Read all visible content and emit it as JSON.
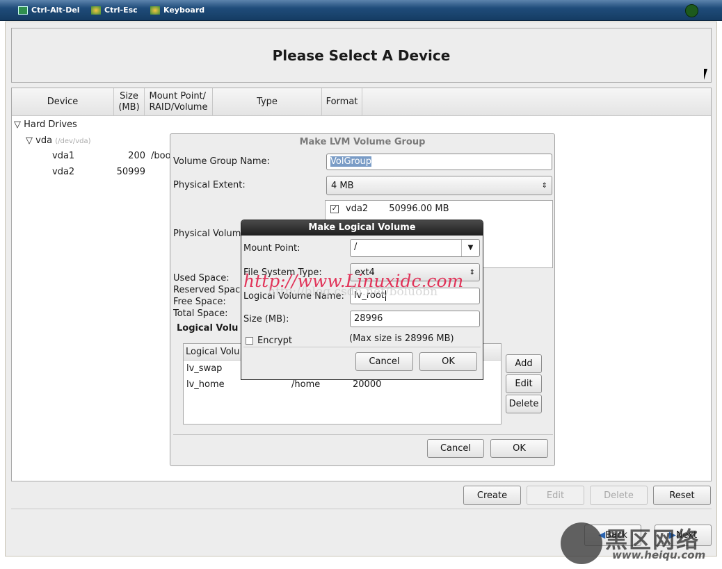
{
  "topbar": {
    "items": [
      {
        "label": "Ctrl-Alt-Del",
        "icon": "monitor-icon"
      },
      {
        "label": "Ctrl-Esc",
        "icon": "app-icon"
      },
      {
        "label": "Keyboard",
        "icon": "keyboard-icon"
      }
    ],
    "status_color": "#1d5a1d"
  },
  "header": {
    "title": "Please Select A Device"
  },
  "table": {
    "columns": [
      "Device",
      "Size\n(MB)",
      "Mount Point/\nRAID/Volume",
      "Type",
      "Format"
    ],
    "group": "Hard Drives",
    "disk": {
      "name": "vda",
      "path": "(/dev/vda)"
    },
    "rows": [
      {
        "device": "vda1",
        "size": "200",
        "mount": "/boo"
      },
      {
        "device": "vda2",
        "size": "50999",
        "mount": ""
      }
    ]
  },
  "lvm_dialog": {
    "title": "Make LVM Volume Group",
    "vg_name_label": "Volume Group Name:",
    "vg_name": "VolGroup",
    "pe_label": "Physical Extent:",
    "pe_value": "4 MB",
    "pv_label": "Physical Volum",
    "pv_list": [
      {
        "checked": true,
        "name": "vda2",
        "size": "50996.00 MB"
      }
    ],
    "space_labels": [
      "Used Space:",
      "Reserved Space",
      "Free Space:",
      "Total Space:"
    ],
    "lv_section": "Logical Volu",
    "lv_header": "Logical Volu",
    "lv_rows": [
      {
        "name": "lv_swap",
        "mount": "",
        "size": ""
      },
      {
        "name": "lv_home",
        "mount": "/home",
        "size": "20000"
      }
    ],
    "add": "Add",
    "edit": "Edit",
    "delete": "Delete",
    "cancel": "Cancel",
    "ok": "OK"
  },
  "lv_dialog": {
    "title": "Make Logical Volume",
    "mount_label": "Mount Point:",
    "mount_value": "/",
    "fs_label": "File System Type:",
    "fs_value": "ext4",
    "name_label": "Logical Volume Name:",
    "name_value": "lv_root",
    "size_label": "Size (MB):",
    "size_value": "28996",
    "encrypt_label": "Encrypt",
    "encrypt_checked": false,
    "max_size": "(Max size is 28996 MB)",
    "cancel": "Cancel",
    "ok": "OK"
  },
  "bottom": {
    "create": "Create",
    "edit": "Edit",
    "delete": "Delete",
    "reset": "Reset",
    "back": "Back",
    "next": "Next"
  },
  "watermarks": {
    "linuxidc": "http://www.Linuxidc.com",
    "csdn": "http://blog.csdn.net/boluobn",
    "heiqu": "黑区网络",
    "heiqu_url": "www.heiqu.com"
  }
}
